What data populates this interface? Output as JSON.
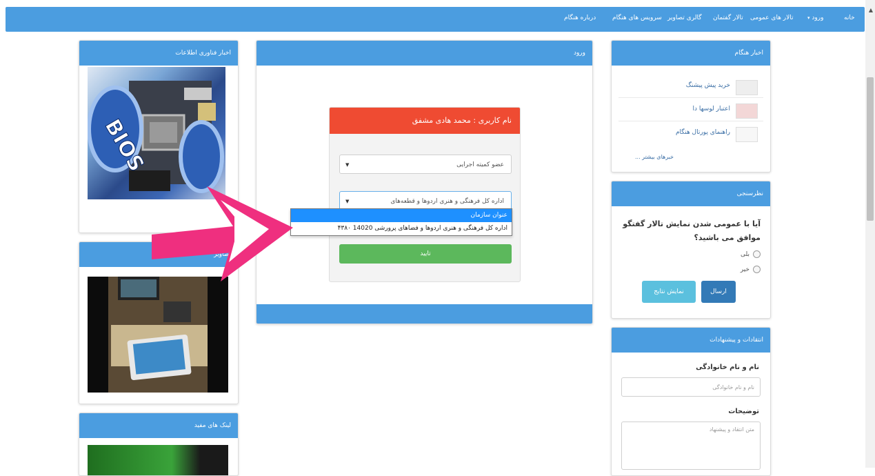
{
  "navbar": {
    "items": [
      {
        "label": "خانه"
      },
      {
        "label": "ورود"
      },
      {
        "label": "تالار های عمومی"
      },
      {
        "label": "تالار گفتمان"
      },
      {
        "label": "گالری تصاویر"
      },
      {
        "label": "سرویس های هنگام"
      },
      {
        "label": "درباره هنگام"
      }
    ]
  },
  "left": {
    "tech_news_title": "اخبار فناوری اطلاعات",
    "images_title": "تصاویر",
    "links_title": "لینک های مفید"
  },
  "login": {
    "panel_title": "ورود",
    "box_title": "نام کاربری : محمد هادی مشفق",
    "select1_value": "عضو کمیته اجرایی",
    "select2_value": "اداره کل فرهنگی و هنری اردوها و قطعه‌های",
    "dropdown_options": [
      "عنوان سازمان",
      "اداره کل فرهنگی و هنری اردوها و فضاهای پرورشی 14020 ۴۳۸۰"
    ],
    "submit_label": "تایید"
  },
  "right": {
    "news_title": "اخبار هنگام",
    "news_items": [
      {
        "label": "خرید پیش پیشنگ"
      },
      {
        "label": "اعتبار لوسها دا"
      },
      {
        "label": "راهنمای پورتال هنگام"
      }
    ],
    "more_link": "خبرهای بیشتر ...",
    "poll_title": "نظرسنجی",
    "poll_question": "آیا با عمومی شدن نمایش تالار گفتگو موافق می باشید؟",
    "poll_yes": "بلی",
    "poll_no": "خیر",
    "send_label": "ارسال",
    "results_label": "نمایش نتایج",
    "feedback_title": "انتقادات و پیشنهادات",
    "name_label": "نام و نام خانوادگی",
    "name_placeholder": "نام و نام خانوادگی",
    "desc_label": "توضیحات",
    "desc_placeholder": "متن انتقاد و پیشنهاد"
  },
  "colors": {
    "navbar": "#4b9de0",
    "login_header": "#ef4b32",
    "submit": "#5cb85c",
    "send": "#337ab7",
    "results": "#5bc0de",
    "annotation_arrow": "#ef2f7f"
  }
}
